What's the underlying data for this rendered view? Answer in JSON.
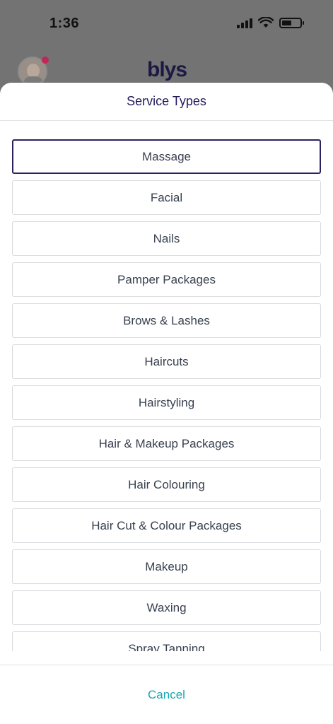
{
  "status_bar": {
    "time": "1:36",
    "battery_level": 0.55
  },
  "app": {
    "brand": "blys"
  },
  "sheet": {
    "title": "Service Types",
    "selected_index": 0,
    "options": [
      "Massage",
      "Facial",
      "Nails",
      "Pamper Packages",
      "Brows & Lashes",
      "Haircuts",
      "Hairstyling",
      "Hair & Makeup Packages",
      "Hair Colouring",
      "Hair Cut & Colour Packages",
      "Makeup",
      "Waxing",
      "Spray Tanning"
    ],
    "cancel_label": "Cancel"
  },
  "colors": {
    "accent": "#19a6b0",
    "title": "#221a5a",
    "selected_border": "#2a2260"
  }
}
